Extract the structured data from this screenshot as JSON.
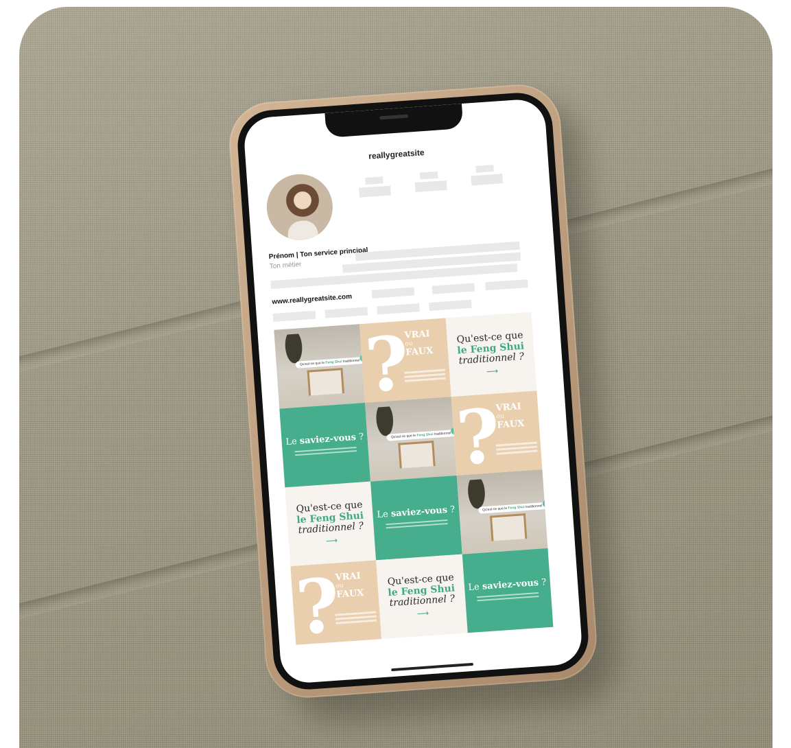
{
  "profile": {
    "username": "reallygreatsite",
    "name_line": "Prénom | Ton service principal",
    "job_line": "Ton métier",
    "website": "www.reallygreatsite.com"
  },
  "posts": {
    "quiz_title": "VRAI",
    "quiz_or": "ou",
    "quiz_title2": "FAUX",
    "question_line1": "Qu'est-ce que",
    "question_accent": "le Feng Shui",
    "question_line2": "traditionnel ?",
    "did_you_know_pre": "Le ",
    "did_you_know_bold": "saviez-vous",
    "did_you_know_post": " ?",
    "search_pill_pre": "Qu'est-ce que le ",
    "search_pill_bold": "Feng Shui",
    "search_pill_post": " traditionnel ?",
    "question_mark": "?"
  },
  "colors": {
    "accent_green": "#46ad8d",
    "beige": "#e9cfae",
    "cream": "#f7f3ee",
    "phone_case": "#c8a987"
  },
  "icons": {
    "arrow": "curved-arrow-icon",
    "search": "search-dot-icon"
  }
}
